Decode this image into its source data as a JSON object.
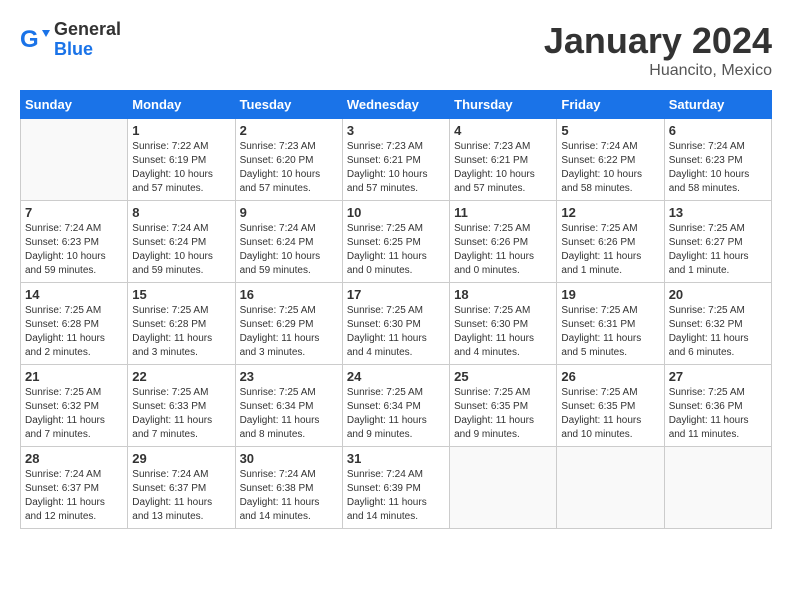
{
  "header": {
    "logo_general": "General",
    "logo_blue": "Blue",
    "month_title": "January 2024",
    "location": "Huancito, Mexico"
  },
  "weekdays": [
    "Sunday",
    "Monday",
    "Tuesday",
    "Wednesday",
    "Thursday",
    "Friday",
    "Saturday"
  ],
  "weeks": [
    [
      {
        "day": "",
        "empty": true
      },
      {
        "day": "1",
        "sunrise": "7:22 AM",
        "sunset": "6:19 PM",
        "daylight": "10 hours and 57 minutes."
      },
      {
        "day": "2",
        "sunrise": "7:23 AM",
        "sunset": "6:20 PM",
        "daylight": "10 hours and 57 minutes."
      },
      {
        "day": "3",
        "sunrise": "7:23 AM",
        "sunset": "6:21 PM",
        "daylight": "10 hours and 57 minutes."
      },
      {
        "day": "4",
        "sunrise": "7:23 AM",
        "sunset": "6:21 PM",
        "daylight": "10 hours and 57 minutes."
      },
      {
        "day": "5",
        "sunrise": "7:24 AM",
        "sunset": "6:22 PM",
        "daylight": "10 hours and 58 minutes."
      },
      {
        "day": "6",
        "sunrise": "7:24 AM",
        "sunset": "6:23 PM",
        "daylight": "10 hours and 58 minutes."
      }
    ],
    [
      {
        "day": "7",
        "sunrise": "7:24 AM",
        "sunset": "6:23 PM",
        "daylight": "10 hours and 59 minutes."
      },
      {
        "day": "8",
        "sunrise": "7:24 AM",
        "sunset": "6:24 PM",
        "daylight": "10 hours and 59 minutes."
      },
      {
        "day": "9",
        "sunrise": "7:24 AM",
        "sunset": "6:24 PM",
        "daylight": "10 hours and 59 minutes."
      },
      {
        "day": "10",
        "sunrise": "7:25 AM",
        "sunset": "6:25 PM",
        "daylight": "11 hours and 0 minutes."
      },
      {
        "day": "11",
        "sunrise": "7:25 AM",
        "sunset": "6:26 PM",
        "daylight": "11 hours and 0 minutes."
      },
      {
        "day": "12",
        "sunrise": "7:25 AM",
        "sunset": "6:26 PM",
        "daylight": "11 hours and 1 minute."
      },
      {
        "day": "13",
        "sunrise": "7:25 AM",
        "sunset": "6:27 PM",
        "daylight": "11 hours and 1 minute."
      }
    ],
    [
      {
        "day": "14",
        "sunrise": "7:25 AM",
        "sunset": "6:28 PM",
        "daylight": "11 hours and 2 minutes."
      },
      {
        "day": "15",
        "sunrise": "7:25 AM",
        "sunset": "6:28 PM",
        "daylight": "11 hours and 3 minutes."
      },
      {
        "day": "16",
        "sunrise": "7:25 AM",
        "sunset": "6:29 PM",
        "daylight": "11 hours and 3 minutes."
      },
      {
        "day": "17",
        "sunrise": "7:25 AM",
        "sunset": "6:30 PM",
        "daylight": "11 hours and 4 minutes."
      },
      {
        "day": "18",
        "sunrise": "7:25 AM",
        "sunset": "6:30 PM",
        "daylight": "11 hours and 4 minutes."
      },
      {
        "day": "19",
        "sunrise": "7:25 AM",
        "sunset": "6:31 PM",
        "daylight": "11 hours and 5 minutes."
      },
      {
        "day": "20",
        "sunrise": "7:25 AM",
        "sunset": "6:32 PM",
        "daylight": "11 hours and 6 minutes."
      }
    ],
    [
      {
        "day": "21",
        "sunrise": "7:25 AM",
        "sunset": "6:32 PM",
        "daylight": "11 hours and 7 minutes."
      },
      {
        "day": "22",
        "sunrise": "7:25 AM",
        "sunset": "6:33 PM",
        "daylight": "11 hours and 7 minutes."
      },
      {
        "day": "23",
        "sunrise": "7:25 AM",
        "sunset": "6:34 PM",
        "daylight": "11 hours and 8 minutes."
      },
      {
        "day": "24",
        "sunrise": "7:25 AM",
        "sunset": "6:34 PM",
        "daylight": "11 hours and 9 minutes."
      },
      {
        "day": "25",
        "sunrise": "7:25 AM",
        "sunset": "6:35 PM",
        "daylight": "11 hours and 9 minutes."
      },
      {
        "day": "26",
        "sunrise": "7:25 AM",
        "sunset": "6:35 PM",
        "daylight": "11 hours and 10 minutes."
      },
      {
        "day": "27",
        "sunrise": "7:25 AM",
        "sunset": "6:36 PM",
        "daylight": "11 hours and 11 minutes."
      }
    ],
    [
      {
        "day": "28",
        "sunrise": "7:24 AM",
        "sunset": "6:37 PM",
        "daylight": "11 hours and 12 minutes."
      },
      {
        "day": "29",
        "sunrise": "7:24 AM",
        "sunset": "6:37 PM",
        "daylight": "11 hours and 13 minutes."
      },
      {
        "day": "30",
        "sunrise": "7:24 AM",
        "sunset": "6:38 PM",
        "daylight": "11 hours and 14 minutes."
      },
      {
        "day": "31",
        "sunrise": "7:24 AM",
        "sunset": "6:39 PM",
        "daylight": "11 hours and 14 minutes."
      },
      {
        "day": "",
        "empty": true
      },
      {
        "day": "",
        "empty": true
      },
      {
        "day": "",
        "empty": true
      }
    ]
  ]
}
